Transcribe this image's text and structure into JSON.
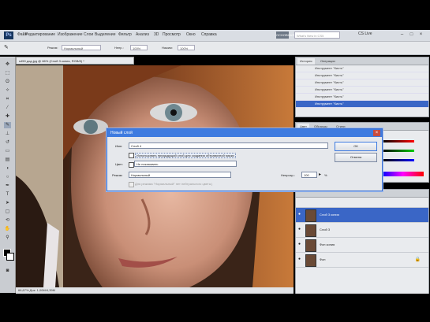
{
  "app": {
    "logo": "Ps",
    "workspace_button": "ОСНОВНАЯ",
    "search_placeholder": "What's New in CS5",
    "cslive": "CS Live"
  },
  "menu": [
    "Файл",
    "Редактирование",
    "Изображение",
    "Слои",
    "Выделение",
    "Фильтр",
    "Анализ",
    "3D",
    "Просмотр",
    "Окно",
    "Справка"
  ],
  "options": {
    "mode_label": "Режим:",
    "mode_value": "Нормальный",
    "opacity_label": "Непр.:",
    "opacity_value": "100%",
    "flow_label": "Нажим:",
    "flow_value": "100%"
  },
  "document": {
    "tab_title": "s450 дод.jpg @ 66% (Слой 3 копия, RGB/8) *",
    "status": "66,67%   Док: 1,00M/4,39M"
  },
  "history": {
    "tabs": [
      "История",
      "Операции"
    ],
    "rows": [
      {
        "label": "Инструмент \"Кисть\"",
        "selected": false
      },
      {
        "label": "Инструмент \"Кисть\"",
        "selected": false
      },
      {
        "label": "Инструмент \"Кисть\"",
        "selected": false
      },
      {
        "label": "Инструмент \"Кисть\"",
        "selected": false
      },
      {
        "label": "Инструмент \"Кисть\"",
        "selected": false
      },
      {
        "label": "Инструмент \"Кисть\"",
        "selected": true
      }
    ]
  },
  "color_panel": {
    "tabs": [
      "Цвет",
      "Образцы",
      "Стили"
    ]
  },
  "layers": {
    "rows": [
      {
        "label": "Слой 3 копия",
        "selected": true
      },
      {
        "label": "Слой 3",
        "selected": false
      },
      {
        "label": "Фон копия",
        "selected": false
      },
      {
        "label": "Фон",
        "selected": false
      }
    ]
  },
  "dialog": {
    "title": "Новый слой",
    "name_label": "Имя:",
    "name_value": "Слой 4",
    "clip_label": "Использовать предыдущий слой для создания обтравочной маски",
    "color_label": "Цвет:",
    "color_value": "Не показывать",
    "mode_label": "Режим:",
    "mode_value": "Нормальный",
    "opacity_label": "Непрозр.:",
    "opacity_value": "100",
    "percent": "%",
    "neutral_label": "Для режима \"Нормальный\" нет нейтрального цвета.)",
    "ok": "ОК",
    "cancel": "Отмена"
  },
  "colors": {
    "accent": "#3e7be0",
    "selection": "#3a66c6"
  }
}
